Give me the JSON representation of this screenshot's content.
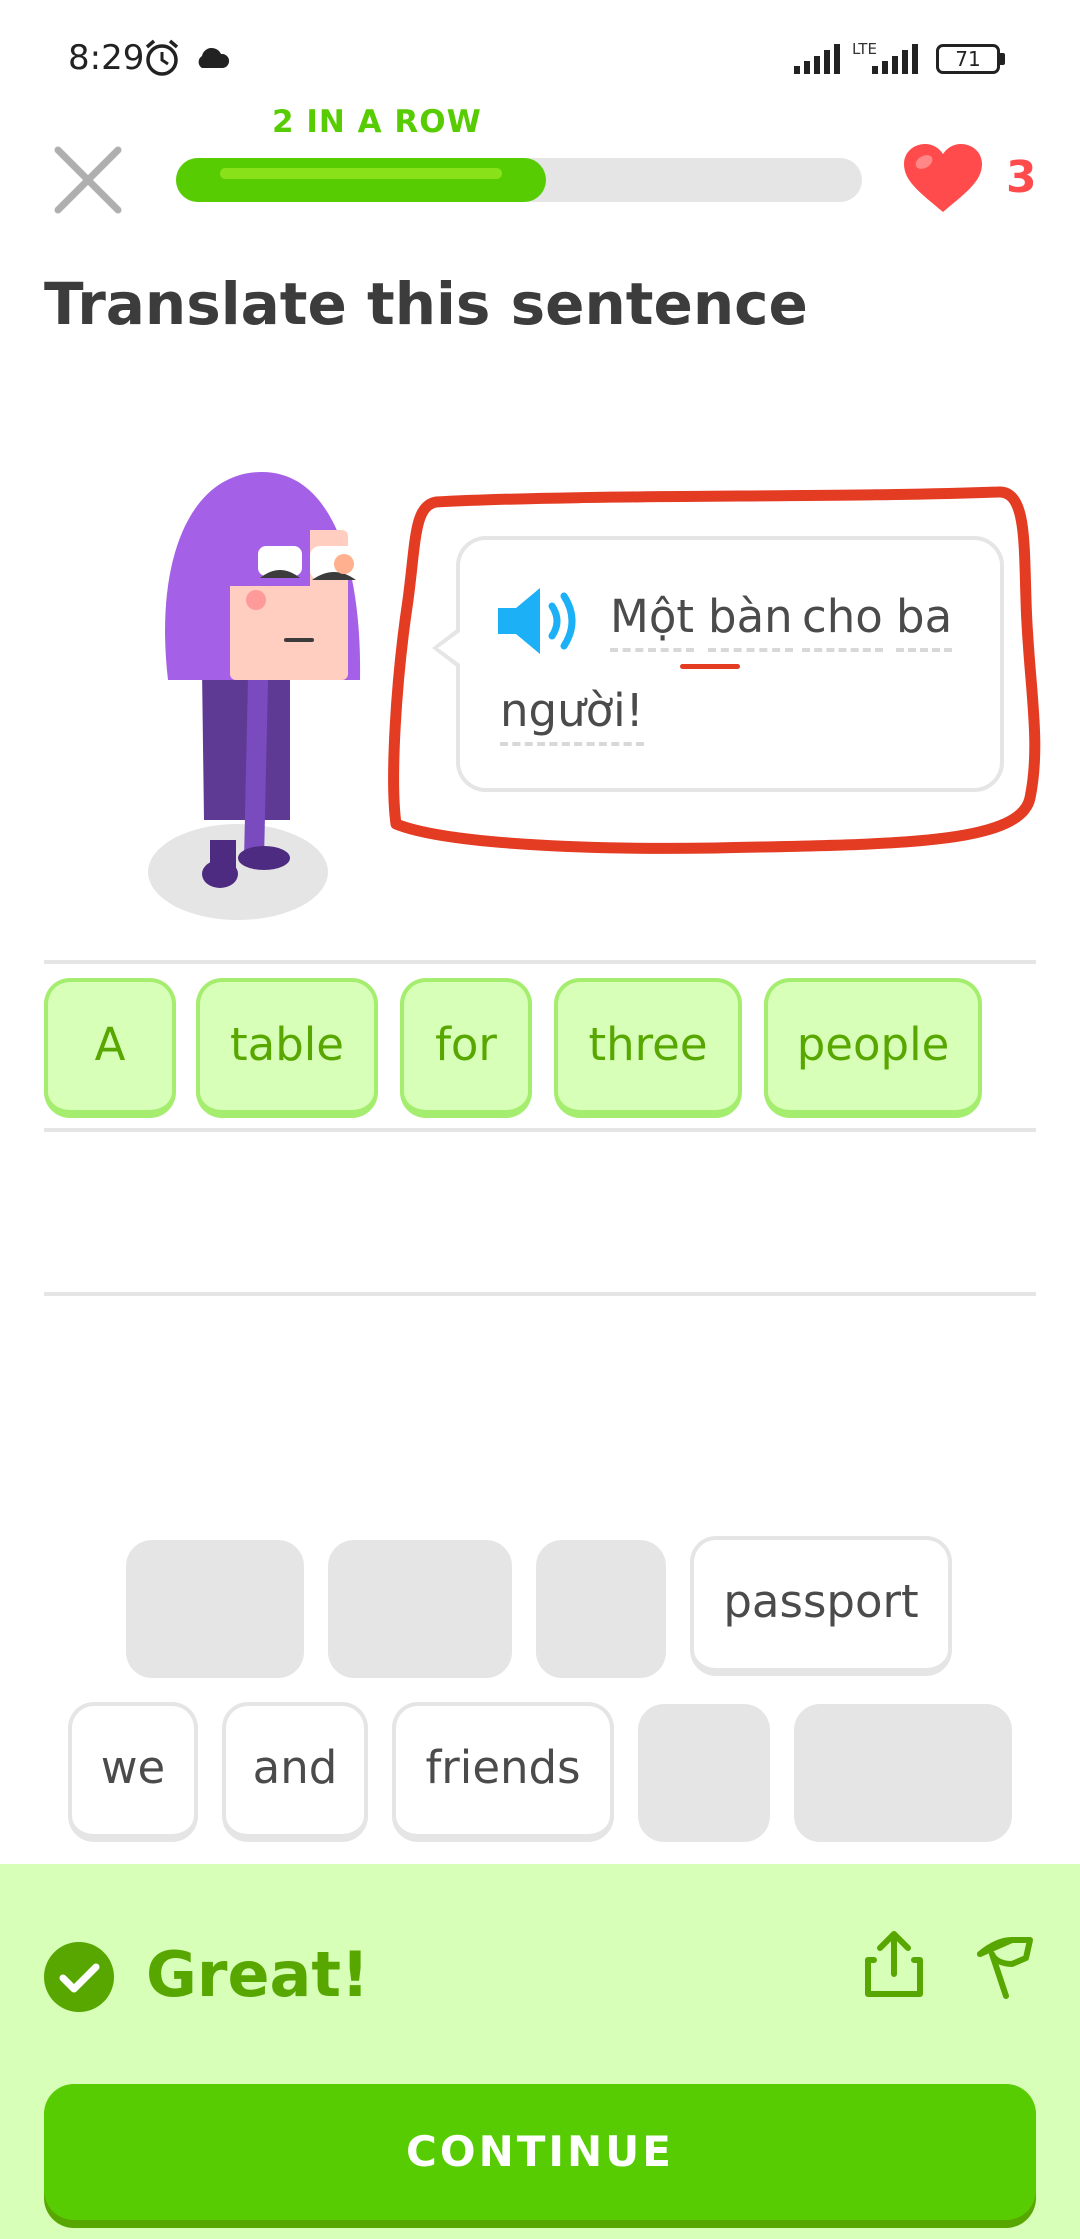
{
  "status_bar": {
    "time": "8:29",
    "network": "LTE",
    "battery": "71"
  },
  "header": {
    "streak_label": "2 IN A ROW",
    "progress_fraction": 0.54,
    "hearts": "3"
  },
  "prompt": {
    "title": "Translate this sentence"
  },
  "speech_bubble": {
    "words": [
      "Một",
      "bàn",
      "cho",
      "ba",
      "người!"
    ]
  },
  "answer_tiles": [
    "A",
    "table",
    "for",
    "three",
    "people"
  ],
  "word_bank": {
    "row1": [
      "",
      "",
      "",
      "passport"
    ],
    "row2": [
      "we",
      "and",
      "friends",
      "",
      ""
    ]
  },
  "feedback": {
    "title": "Great!",
    "button": "CONTINUE"
  },
  "colors": {
    "accent_green": "#58cc02",
    "dark_green": "#58a700",
    "light_green": "#d7ffb8",
    "heart_red": "#ff4b4b",
    "annotation_red": "#e43b23"
  }
}
